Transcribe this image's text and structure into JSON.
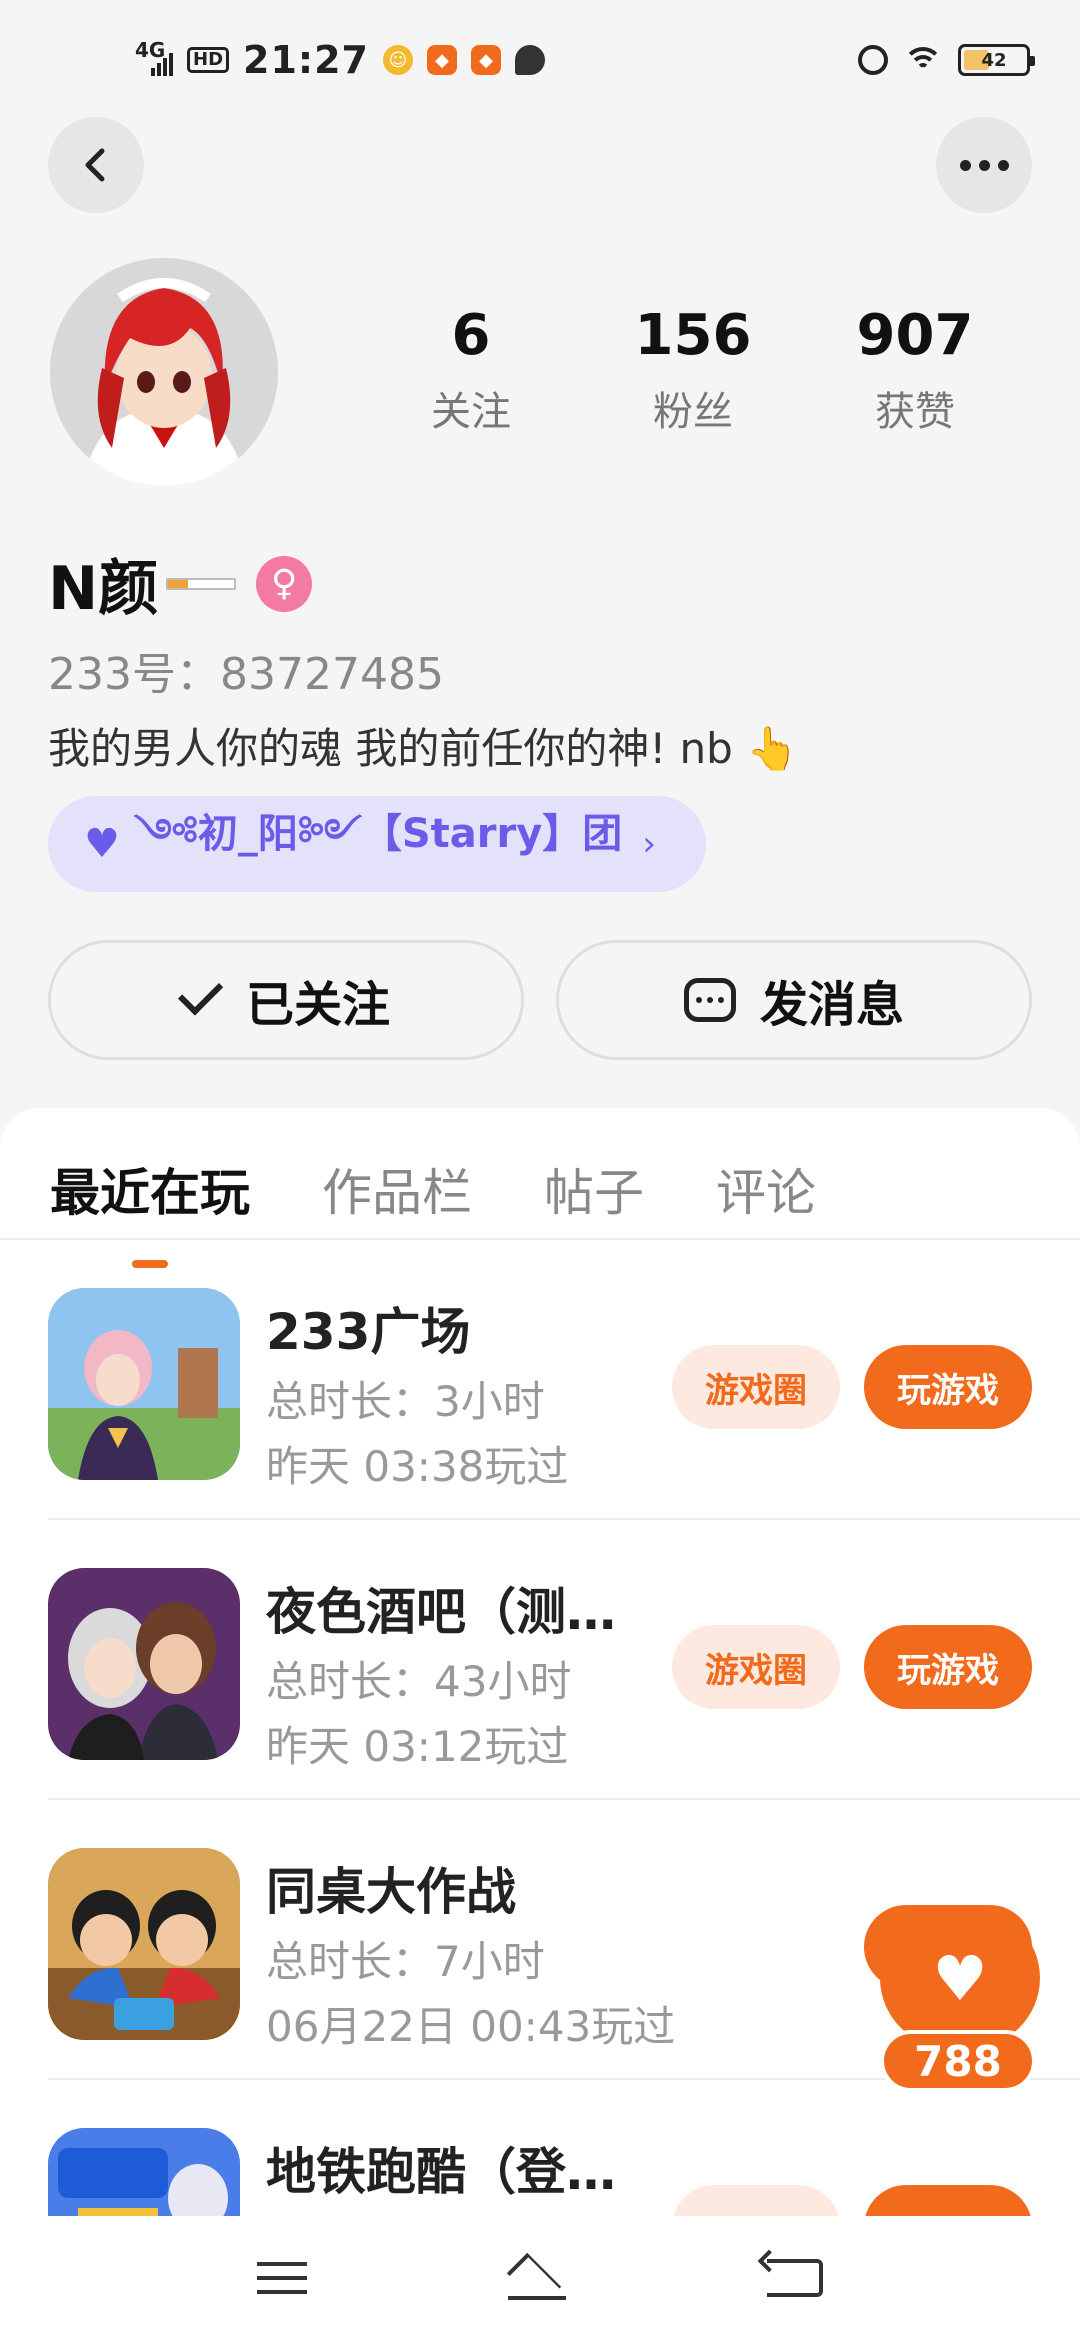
{
  "status_bar": {
    "network": "4G",
    "hd": "HD",
    "time": "21:27",
    "battery": "42",
    "battery_level": 0.42
  },
  "profile": {
    "stats": [
      {
        "num": "6",
        "label": "关注"
      },
      {
        "num": "156",
        "label": "粉丝"
      },
      {
        "num": "907",
        "label": "获赞"
      }
    ],
    "nickname": "N颜",
    "gender_symbol": "♀",
    "uid": "233号：83727485",
    "bio": "我的男人你的魂 我的前任你的神! nb 👆",
    "team": "༺初_阳༻【Starry】团",
    "follow_label": "已关注",
    "message_label": "发消息"
  },
  "tabs": [
    "最近在玩",
    "作品栏",
    "帖子",
    "评论"
  ],
  "games": [
    {
      "title": "233广场",
      "total": "总时长：3小时",
      "last": "昨天 03:38玩过",
      "circle_label": "游戏圈",
      "play_label": "玩游戏"
    },
    {
      "title": "夜色酒吧（测…",
      "total": "总时长：43小时",
      "last": "昨天 03:12玩过",
      "circle_label": "游戏圈",
      "play_label": "玩游戏"
    },
    {
      "title": "同桌大作战",
      "total": "总时长：7小时",
      "last": "06月22日 00:43玩过",
      "circle_label": "",
      "play_label": ""
    },
    {
      "title": "地铁跑酷（登…",
      "total": "",
      "last": "",
      "circle_label": "",
      "play_label": ""
    }
  ],
  "like_float": {
    "count": "788"
  },
  "colors": {
    "accent": "#f26a1b",
    "team_purple": "#6a5ce8",
    "pink": "#f37aa2"
  }
}
